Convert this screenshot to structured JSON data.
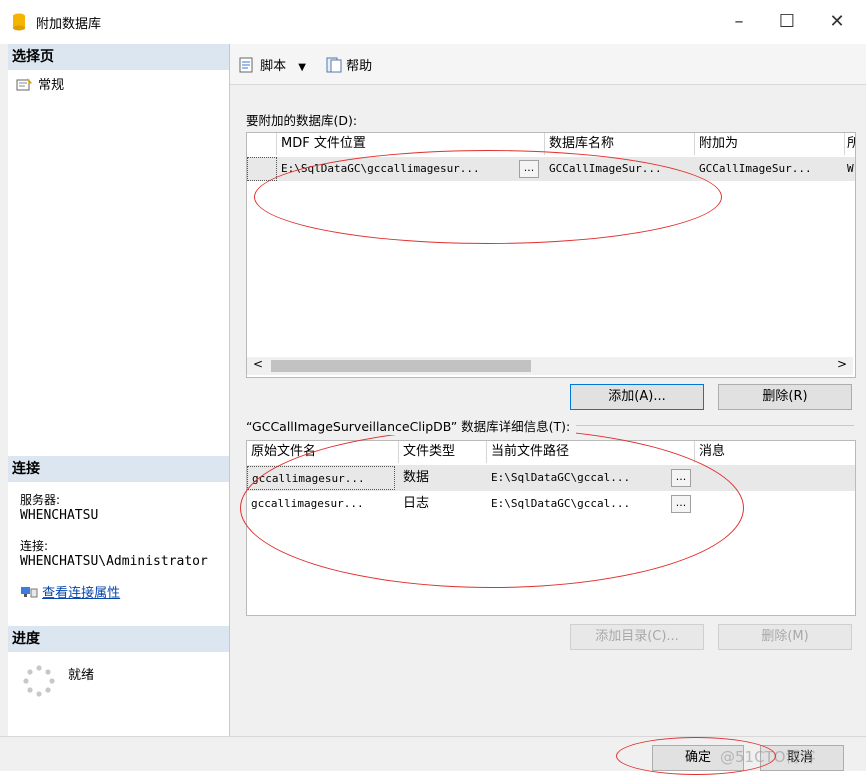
{
  "window": {
    "title": "附加数据库",
    "minimize": "–",
    "maximize": "☐",
    "close": "✕"
  },
  "left": {
    "select_page": "选择页",
    "pages": [
      "常规"
    ],
    "connect_head": "连接",
    "server_label": "服务器:",
    "server_value": "WHENCHATSU",
    "connection_label": "连接:",
    "connection_value": "WHENCHATSU\\Administrator",
    "view_props_link": "查看连接属性",
    "progress_head": "进度",
    "progress_status": "就绪"
  },
  "toolbar": {
    "script": "脚本",
    "help": "帮助"
  },
  "attach": {
    "label": "要附加的数据库(D):",
    "columns": [
      "MDF 文件位置",
      "数据库名称",
      "附加为",
      "所"
    ],
    "rows": [
      {
        "mdf": "E:\\SqlDataGC\\gccallimagesur...",
        "db_name": "GCCallImageSur...",
        "attach_as": "GCCallImageSur...",
        "owner": "W"
      }
    ],
    "dots": "...",
    "add_button": "添加(A)...",
    "remove_button": "删除(R)"
  },
  "details": {
    "label": "“GCCallImageSurveillanceClipDB” 数据库详细信息(T):",
    "columns": [
      "原始文件名",
      "文件类型",
      "当前文件路径",
      "消息"
    ],
    "rows": [
      {
        "file": "gccallimagesur...",
        "type": "数据",
        "path": "E:\\SqlDataGC\\gccal..."
      },
      {
        "file": "gccallimagesur...",
        "type": "日志",
        "path": "E:\\SqlDataGC\\gccal..."
      }
    ],
    "dots": "...",
    "add_catalog_button": "添加目录(C)...",
    "remove_button": "删除(M)"
  },
  "footer": {
    "ok_button": "确定",
    "cancel_button": "取消",
    "watermark": "@51CTO博客"
  },
  "colors": {
    "accent": "#0078d7",
    "annotation": "#e0302e",
    "section_header": "#dce6f0"
  }
}
